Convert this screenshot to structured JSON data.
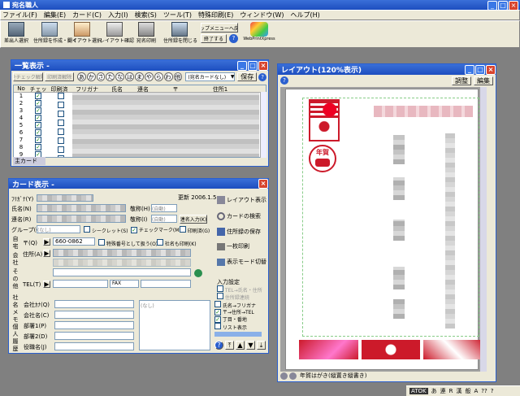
{
  "app": {
    "title": "宛名職人"
  },
  "menu": [
    "ファイル(F)",
    "編集(E)",
    "カード(C)",
    "入力(I)",
    "検索(S)",
    "ツール(T)",
    "特殊印刷(E)",
    "ウィンドウ(W)",
    "ヘルプ(H)"
  ],
  "toolbar": {
    "buttons": [
      "差出人選択",
      "住所録を作成・開く",
      "レイアウト選択",
      "レイアウト確認",
      "宛名印刷",
      "住所録を閉じる"
    ],
    "top_menu_label": "トップメニューへ戻る",
    "exit_label": "終了する",
    "webprint_label": "WebPrintXpress"
  },
  "list_window": {
    "title": "一覧表示 -",
    "btn_check_all": "全チェック解除",
    "btn_print_mark": "印刷済解除",
    "kana": [
      "あ",
      "か",
      "さ",
      "た",
      "な",
      "は",
      "ま",
      "や",
      "ら",
      "わ",
      "他"
    ],
    "group_select": "(宛名カードなし)",
    "save_label": "保存",
    "headers": [
      "No",
      "チェック",
      "印刷済",
      "フリガナ",
      "氏名",
      "連名",
      "〒",
      "住所1"
    ],
    "rows": [
      "1",
      "2",
      "3",
      "4",
      "5",
      "6",
      "7",
      "8",
      "9"
    ],
    "footer": "主カード"
  },
  "card_window": {
    "title": "カード表示 -",
    "updated_label": "更新",
    "updated_value": "2006.1.5",
    "furigana_label": "ﾌﾘｶﾞﾅ(Y)",
    "name_label": "氏名(N)",
    "renmei_label": "連名(R)",
    "group_label": "グループ(G)",
    "group_value": "(なし)",
    "keisho_label": "敬称(H)",
    "keisho_value": "(自動)",
    "keisho2_label": "敬称(I)",
    "keisho2_value": "(自動)",
    "renmei_input_label": "連名入力(K)",
    "seal_label": "シークレット(S)",
    "checkmark_label": "チェックマーク(M)",
    "printed_label": "印刷済(G)",
    "home_tab": "自宅",
    "company_tab": "会社",
    "other_tab": "その他",
    "zip_label": "〒(Q)",
    "zip_value": "660-0862",
    "special_label": "特殊番号として扱う(O)",
    "company_print_label": "社名も印刷(K)",
    "address_label": "住所(A)",
    "tel_label": "TEL(T)",
    "fax_label": "FAX",
    "company_section": "社名",
    "memo_section": "メモ",
    "personal_section": "個人",
    "history_section": "履歴",
    "company_kana_label": "会社ｶﾅ(Q)",
    "company_name_label": "会社名(C)",
    "dept1_label": "部署1(P)",
    "dept2_label": "部署2(D)",
    "position_label": "役職名(J)",
    "memo_label": "(なし)",
    "side": {
      "layout": "レイアウト表示",
      "search": "カードの検索",
      "save": "住所録の保存",
      "print_one": "一枚印刷",
      "mode": "表示モード切替",
      "input_title": "入力設定",
      "tel_company": "TEL→氏名・住所",
      "auto_kana": "住所録連続",
      "name_kana": "氏名→フリガナ",
      "zip_tel": "〒→住所→TEL",
      "town": "丁目・番地",
      "list_display": "リスト表示"
    }
  },
  "layout_window": {
    "title": "レイアウト(120%表示)",
    "adjust_label": "調整",
    "edit_label": "編集",
    "nenga": "年賀",
    "status_text": "年賀はがき(縦置き縦書き)"
  },
  "taskbar": {
    "items": [
      "ATOK",
      "あ",
      "連",
      "R",
      "漢",
      "般",
      "A",
      "??",
      "?"
    ]
  },
  "colors": {
    "accent": "#cc1a2a",
    "titlebar": "#2a5fcf"
  }
}
